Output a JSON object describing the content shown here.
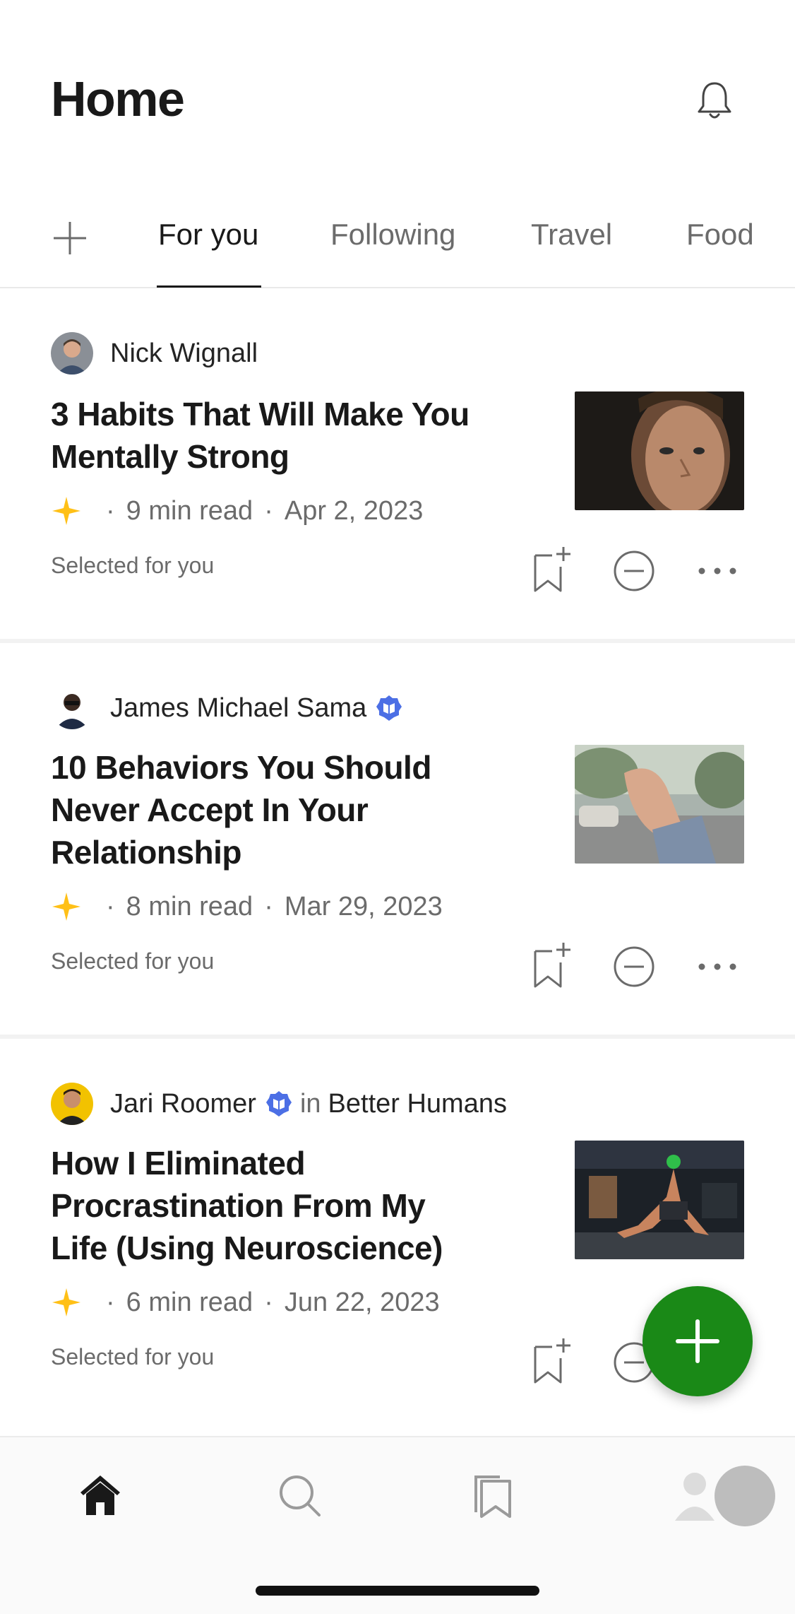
{
  "header": {
    "title": "Home"
  },
  "tabs": [
    {
      "label": "For you",
      "active": true
    },
    {
      "label": "Following",
      "active": false
    },
    {
      "label": "Travel",
      "active": false
    },
    {
      "label": "Food",
      "active": false
    }
  ],
  "articles": [
    {
      "author": "Nick Wignall",
      "verified": false,
      "publication": "",
      "title_lines": [
        "3 Habits That Will Make You",
        "Mentally Strong"
      ],
      "read_time": "9  min read",
      "date": "Apr 2, 2023",
      "selected_label": "Selected for you"
    },
    {
      "author": "James Michael Sama",
      "verified": true,
      "publication": "",
      "title_lines": [
        "10 Behaviors You Should",
        "Never Accept In Your",
        "Relationship"
      ],
      "read_time": "8  min read",
      "date": "Mar 29, 2023",
      "selected_label": "Selected for you"
    },
    {
      "author": "Jari Roomer",
      "verified": true,
      "in_word": "in",
      "publication": "Better Humans",
      "title_lines": [
        "How I Eliminated",
        "Procrastination From My",
        "Life (Using Neuroscience)"
      ],
      "read_time": "6  min read",
      "date": "Jun 22, 2023",
      "selected_label": "Selected for you"
    }
  ],
  "separator": "·",
  "colors": {
    "accent_green": "#1a8917",
    "member_star": "#ffc017",
    "verified_blue": "#4c6fe5"
  },
  "icons": {
    "notification": "bell-icon",
    "add_topic": "plus-icon",
    "save": "bookmark-add-icon",
    "show_less": "minus-circle-icon",
    "more": "more-dots-icon",
    "write": "plus-icon",
    "nav": [
      "home-icon",
      "search-icon",
      "library-icon",
      "profile-icon"
    ]
  }
}
